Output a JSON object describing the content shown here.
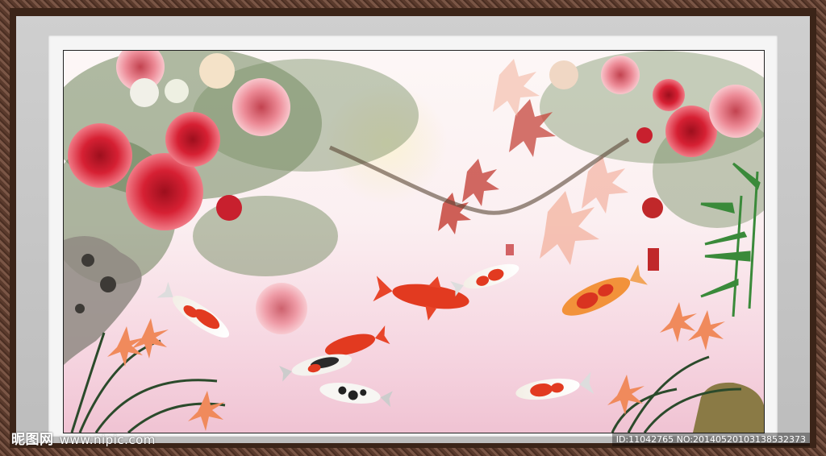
{
  "artwork": {
    "subject": "koi",
    "seal_color": "#c0282a"
  },
  "watermark": {
    "site_logo_text": "昵图网",
    "site_url": "www.nipic.com",
    "image_id_line": "ID:11042765 NO:20140520103138532373"
  },
  "colors": {
    "peony_red": "#d62033",
    "peony_pink": "#e8707e",
    "leaf_green": "#4b6b3a",
    "maple_red": "#c6453c",
    "bamboo_green": "#3a8a3a",
    "koi_red": "#e23a20",
    "background_pink": "#f0c3d3"
  }
}
